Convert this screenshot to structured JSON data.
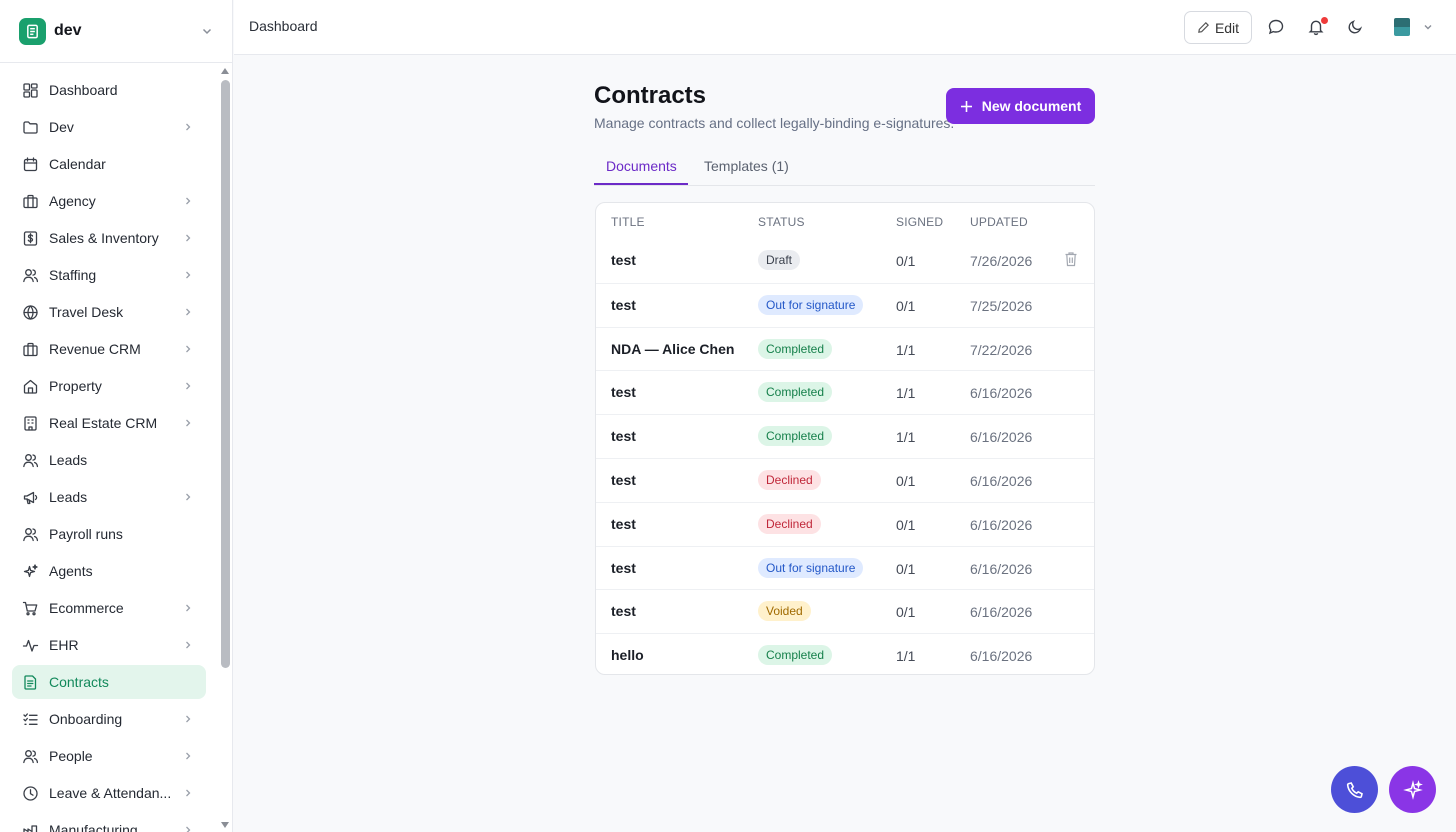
{
  "workspace": {
    "name": "dev"
  },
  "sidebar": {
    "items": [
      {
        "label": "Dashboard",
        "icon": "dashboard-icon",
        "chevron": false,
        "active": false
      },
      {
        "label": "Dev",
        "icon": "folder-icon",
        "chevron": true,
        "active": false
      },
      {
        "label": "Calendar",
        "icon": "calendar-icon",
        "chevron": false,
        "active": false
      },
      {
        "label": "Agency",
        "icon": "building-icon",
        "chevron": true,
        "active": false
      },
      {
        "label": "Sales & Inventory",
        "icon": "dollar-icon",
        "chevron": true,
        "active": false
      },
      {
        "label": "Staffing",
        "icon": "users-icon",
        "chevron": true,
        "active": false
      },
      {
        "label": "Travel Desk",
        "icon": "globe-icon",
        "chevron": true,
        "active": false
      },
      {
        "label": "Revenue CRM",
        "icon": "building-icon",
        "chevron": true,
        "active": false
      },
      {
        "label": "Property",
        "icon": "home-icon",
        "chevron": true,
        "active": false
      },
      {
        "label": "Real Estate CRM",
        "icon": "office-icon",
        "chevron": true,
        "active": false
      },
      {
        "label": "Leads",
        "icon": "users-icon",
        "chevron": false,
        "active": false
      },
      {
        "label": "Leads",
        "icon": "megaphone-icon",
        "chevron": true,
        "active": false
      },
      {
        "label": "Payroll runs",
        "icon": "users-icon",
        "chevron": false,
        "active": false
      },
      {
        "label": "Agents",
        "icon": "sparkle-icon",
        "chevron": false,
        "active": false
      },
      {
        "label": "Ecommerce",
        "icon": "cart-icon",
        "chevron": true,
        "active": false
      },
      {
        "label": "EHR",
        "icon": "activity-icon",
        "chevron": true,
        "active": false
      },
      {
        "label": "Contracts",
        "icon": "document-icon",
        "chevron": false,
        "active": true
      },
      {
        "label": "Onboarding",
        "icon": "checklist-icon",
        "chevron": true,
        "active": false
      },
      {
        "label": "People",
        "icon": "users-icon",
        "chevron": true,
        "active": false
      },
      {
        "label": "Leave & Attendan...",
        "icon": "clock-icon",
        "chevron": true,
        "active": false
      },
      {
        "label": "Manufacturing",
        "icon": "factory-icon",
        "chevron": true,
        "active": false
      }
    ]
  },
  "header": {
    "breadcrumb": "Dashboard",
    "edit_label": "Edit"
  },
  "page": {
    "title": "Contracts",
    "subtitle": "Manage contracts and collect legally-binding e-signatures.",
    "new_button_label": "New document"
  },
  "tabs": [
    {
      "label": "Documents",
      "active": true
    },
    {
      "label": "Templates (1)",
      "active": false
    }
  ],
  "table": {
    "columns": [
      "TITLE",
      "STATUS",
      "SIGNED",
      "UPDATED"
    ],
    "rows": [
      {
        "title": "test",
        "status": "Draft",
        "signed": "0/1",
        "updated": "7/26/2026",
        "deletable": true
      },
      {
        "title": "test",
        "status": "Out for signature",
        "signed": "0/1",
        "updated": "7/25/2026",
        "deletable": false
      },
      {
        "title": "NDA — Alice Chen",
        "status": "Completed",
        "signed": "1/1",
        "updated": "7/22/2026",
        "deletable": false
      },
      {
        "title": "test",
        "status": "Completed",
        "signed": "1/1",
        "updated": "6/16/2026",
        "deletable": false
      },
      {
        "title": "test",
        "status": "Completed",
        "signed": "1/1",
        "updated": "6/16/2026",
        "deletable": false
      },
      {
        "title": "test",
        "status": "Declined",
        "signed": "0/1",
        "updated": "6/16/2026",
        "deletable": false
      },
      {
        "title": "test",
        "status": "Declined",
        "signed": "0/1",
        "updated": "6/16/2026",
        "deletable": false
      },
      {
        "title": "test",
        "status": "Out for signature",
        "signed": "0/1",
        "updated": "6/16/2026",
        "deletable": false
      },
      {
        "title": "test",
        "status": "Voided",
        "signed": "0/1",
        "updated": "6/16/2026",
        "deletable": false
      },
      {
        "title": "hello",
        "status": "Completed",
        "signed": "1/1",
        "updated": "6/16/2026",
        "deletable": false
      }
    ]
  },
  "colors": {
    "accent": "#7c2ee0",
    "sidebar_active_bg": "#e3f5ec",
    "sidebar_active_text": "#12895b",
    "brand": "#1aa06d"
  }
}
